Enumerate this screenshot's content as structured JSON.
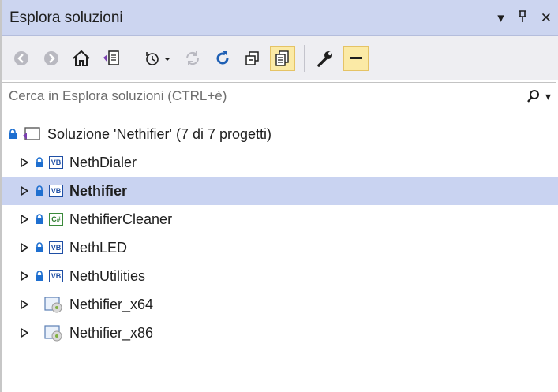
{
  "window": {
    "title": "Esplora soluzioni",
    "buttons": [
      "▾",
      "⊥",
      "✕"
    ]
  },
  "toolbar": {
    "icons": [
      "back-icon",
      "forward-icon",
      "home-icon",
      "solution-view-icon",
      "pending-changes-icon",
      "sync-icon",
      "refresh-icon",
      "collapse-all-icon",
      "show-all-files-icon",
      "properties-icon",
      "preview-icon"
    ],
    "active_color": "#fbeaa6"
  },
  "search": {
    "placeholder": "Cerca in Esplora soluzioni (CTRL+è)",
    "search_glyph": "⚲",
    "dropdown_glyph": "▾"
  },
  "tree": {
    "solution_label": "Soluzione 'Nethifier' (7 di 7 progetti)",
    "items": [
      {
        "label": "NethDialer",
        "kind": "vb",
        "locked": true,
        "selected": false,
        "bold": false
      },
      {
        "label": "Nethifier",
        "kind": "vb",
        "locked": true,
        "selected": true,
        "bold": true
      },
      {
        "label": "NethifierCleaner",
        "kind": "cs",
        "locked": true,
        "selected": false,
        "bold": false
      },
      {
        "label": "NethLED",
        "kind": "vb",
        "locked": true,
        "selected": false,
        "bold": false
      },
      {
        "label": "NethUtilities",
        "kind": "vb",
        "locked": true,
        "selected": false,
        "bold": false
      },
      {
        "label": "Nethifier_x64",
        "kind": "setup",
        "locked": false,
        "selected": false,
        "bold": false
      },
      {
        "label": "Nethifier_x86",
        "kind": "setup",
        "locked": false,
        "selected": false,
        "bold": false
      }
    ],
    "badges": {
      "vb": "VB",
      "cs": "C#"
    },
    "selection_color": "#c9d3f1"
  }
}
